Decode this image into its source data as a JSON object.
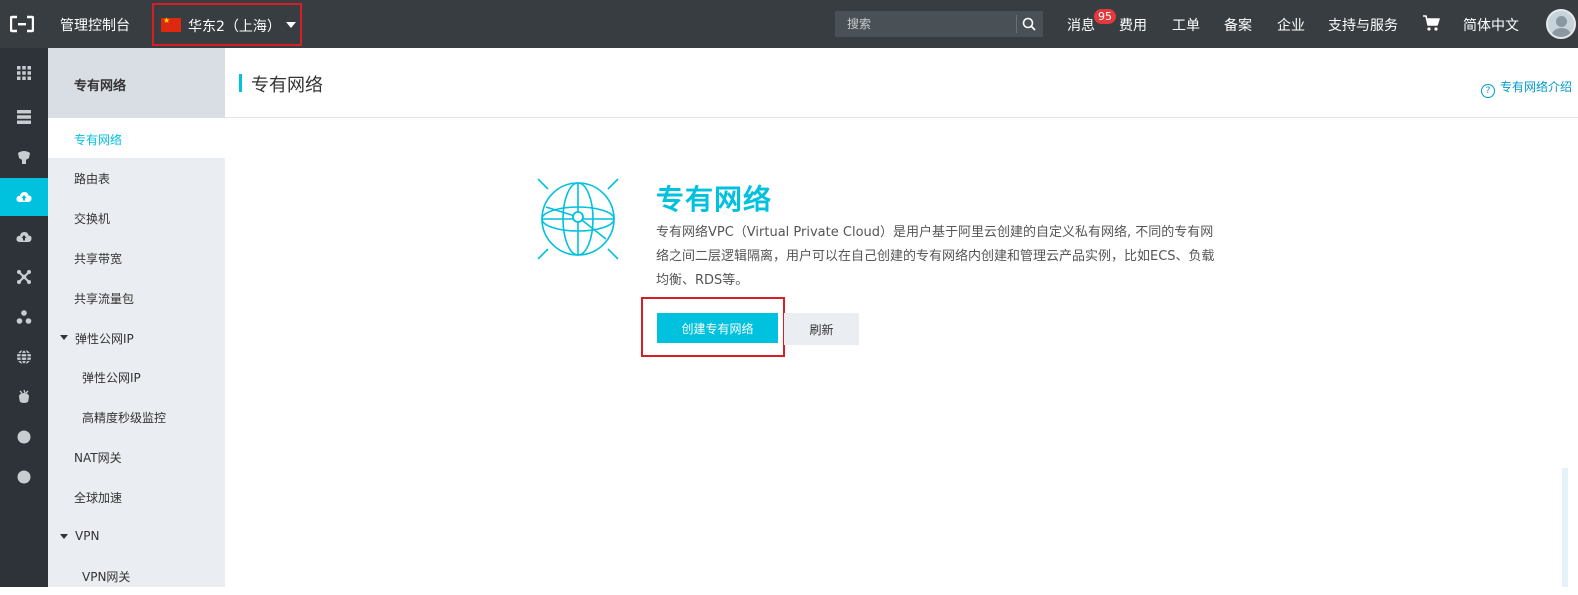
{
  "topbar": {
    "console_title": "管理控制台",
    "region": "华东2（上海）",
    "search_placeholder": "搜索",
    "messages_label": "消息",
    "messages_badge": "95",
    "nav": [
      "费用",
      "工单",
      "备案",
      "企业",
      "支持与服务"
    ],
    "language": "简体中文"
  },
  "subnav": {
    "title": "专有网络",
    "items": [
      {
        "label": "专有网络"
      },
      {
        "label": "路由表"
      },
      {
        "label": "交换机"
      },
      {
        "label": "共享带宽"
      },
      {
        "label": "共享流量包"
      },
      {
        "label": "弹性公网IP"
      },
      {
        "label": "弹性公网IP"
      },
      {
        "label": "高精度秒级监控"
      },
      {
        "label": "NAT网关"
      },
      {
        "label": "全球加速"
      },
      {
        "label": "VPN"
      },
      {
        "label": "VPN网关"
      }
    ]
  },
  "main": {
    "page_title": "专有网络",
    "help_link": "专有网络介绍",
    "hero_title": "专有网络",
    "hero_desc": "专有网络VPC（Virtual Private Cloud）是用户基于阿里云创建的自定义私有网络, 不同的专有网络之间二层逻辑隔离，用户可以在自己创建的专有网络内创建和管理云产品实例，比如ECS、负载均衡、RDS等。",
    "create_button": "创建专有网络",
    "refresh_button": "刷新"
  },
  "colors": {
    "accent": "#00c1de",
    "topbar": "#373d41",
    "iconbar": "#2d3338",
    "highlight_box": "#d61f24"
  },
  "icons": [
    "logo-icon",
    "cn-flag-icon",
    "caret-down-icon",
    "search-icon",
    "cart-icon",
    "apps-grid-icon",
    "server-icon",
    "cloud-upload-icon",
    "network-icon",
    "globe-icon"
  ]
}
